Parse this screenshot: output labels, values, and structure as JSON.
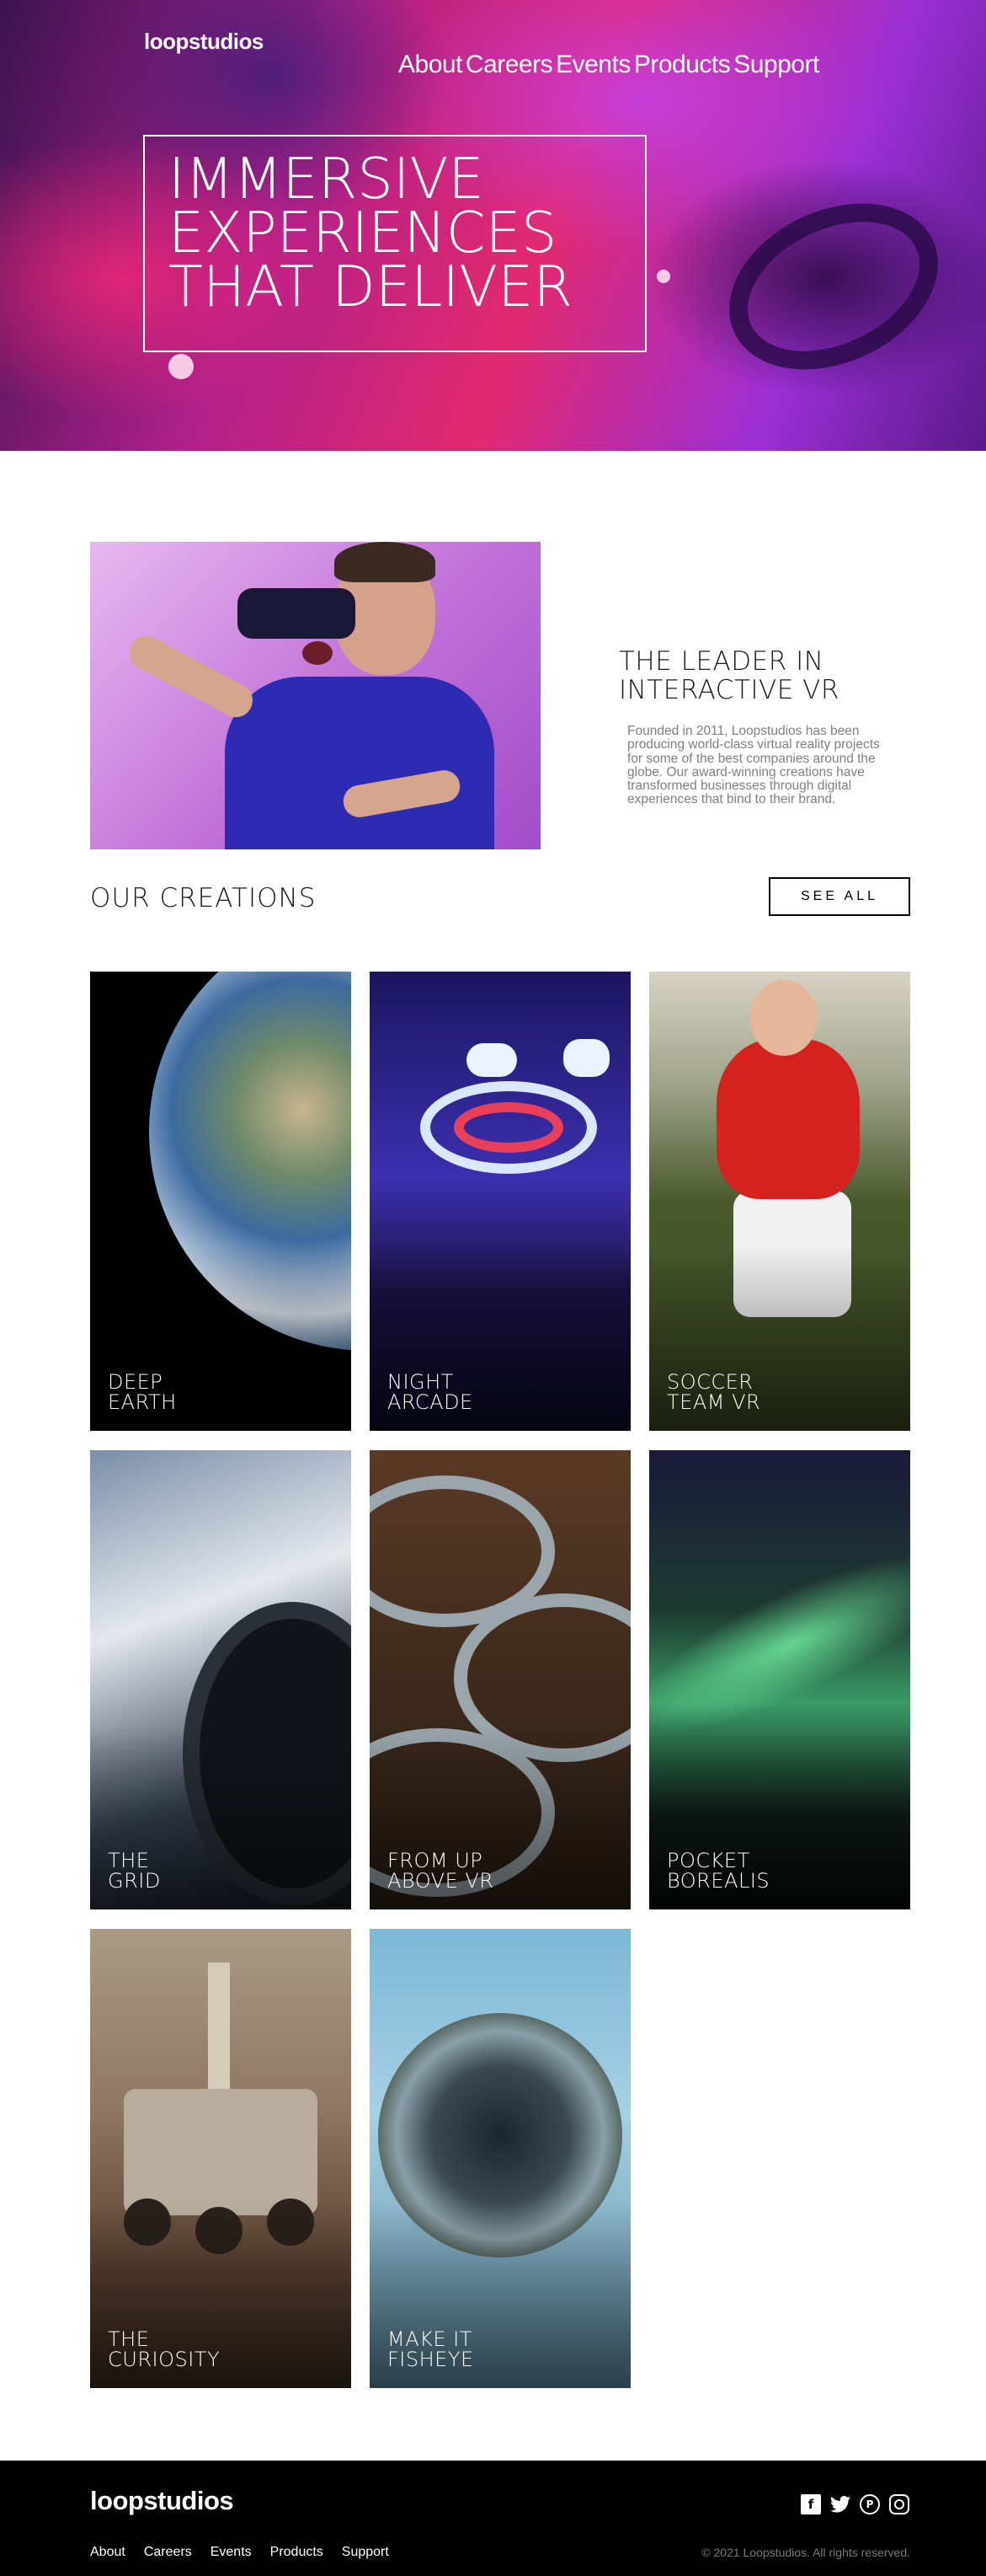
{
  "header": {
    "logo": "loopstudios",
    "nav": [
      "About",
      "Careers",
      "Events",
      "Products",
      "Support"
    ]
  },
  "hero": {
    "title_lines": [
      "IMMERSIVE",
      "EXPERIENCES",
      "THAT DELIVER"
    ]
  },
  "about": {
    "title_lines": [
      "THE LEADER IN",
      "INTERACTIVE VR"
    ],
    "body": "Founded in 2011, Loopstudios has been producing world-class virtual reality projects for some of the best companies around the globe. Our award-winning creations have transformed businesses through digital experiences that bind to their brand."
  },
  "creations": {
    "title": "OUR CREATIONS",
    "see_all": "SEE ALL",
    "items": [
      {
        "lines": [
          "DEEP",
          "EARTH"
        ]
      },
      {
        "lines": [
          "NIGHT",
          "ARCADE"
        ]
      },
      {
        "lines": [
          "SOCCER",
          "TEAM VR"
        ]
      },
      {
        "lines": [
          "THE",
          "GRID"
        ]
      },
      {
        "lines": [
          "FROM UP",
          "ABOVE VR"
        ]
      },
      {
        "lines": [
          "POCKET",
          "BOREALIS"
        ]
      },
      {
        "lines": [
          "THE",
          "CURIOSITY"
        ]
      },
      {
        "lines": [
          "MAKE IT",
          "FISHEYE"
        ]
      }
    ]
  },
  "footer": {
    "logo": "loopstudios",
    "nav": [
      "About",
      "Careers",
      "Events",
      "Products",
      "Support"
    ],
    "social_icons": [
      "facebook-icon",
      "twitter-icon",
      "pinterest-icon",
      "instagram-icon"
    ],
    "copyright": "© 2021 Loopstudios. All rights reserved."
  }
}
